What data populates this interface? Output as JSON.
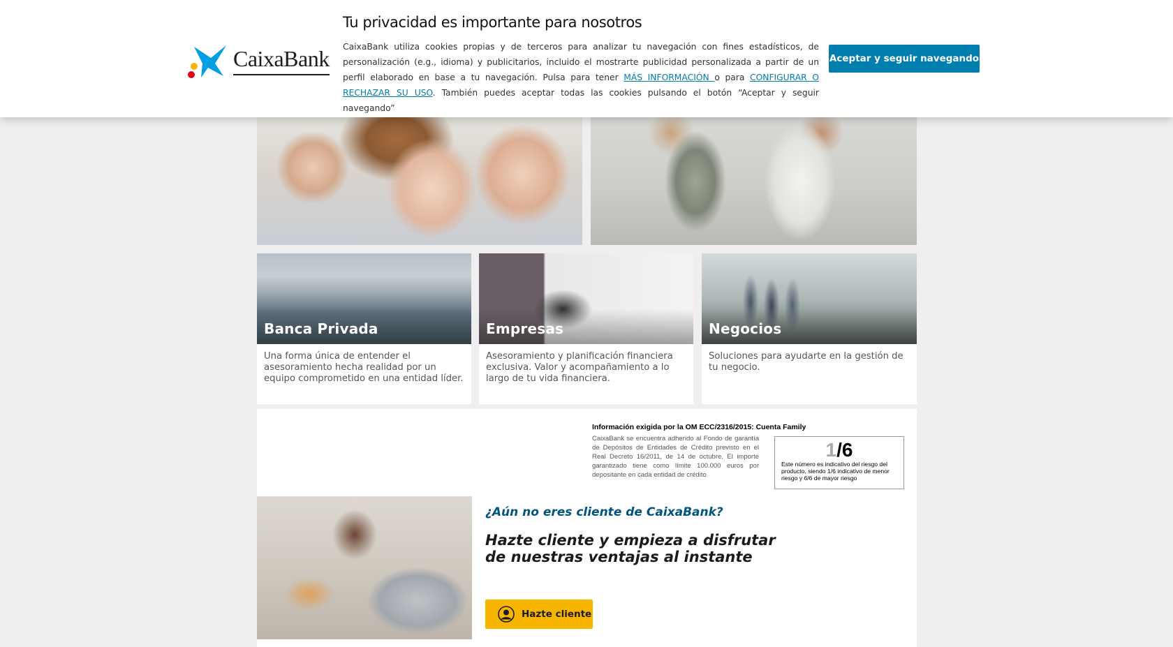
{
  "cookie_banner": {
    "logo_text": "CaixaBank",
    "title": "Tu privacidad es importante para nosotros",
    "text_part1": "CaixaBank utiliza cookies propias y de terceros para analizar tu navegación con fines estadísticos, de personalización (e.g., idioma) y publicitarios, incluido el mostrarte publicidad personalizada a partir de un perfil elaborado en base a tu navegación. Pulsa para tener ",
    "link_more": "MÁS INFORMACIÓN ",
    "text_part2": "o para ",
    "link_configure": "CONFIGURAR O RECHAZAR SU USO",
    "text_part3": ". También puedes aceptar todas las cookies pulsando el botón “Aceptar y seguir navegando”",
    "accept_button": "Aceptar y seguir navegando"
  },
  "cards": [
    {
      "title": "Banca Privada",
      "description": "Una forma única de entender el asesoramiento hecha realidad por un equipo comprometido en una entidad líder."
    },
    {
      "title": "Empresas",
      "description": "Asesoramiento y planificación financiera exclusiva. Valor y acompañamiento a lo largo de tu vida financiera."
    },
    {
      "title": "Negocios",
      "description": "Soluciones para ayudarte en la gestión de tu negocio."
    }
  ],
  "om_info": {
    "title": "Información exigida por la OM ECC/2316/2015: Cuenta Family",
    "text": "CaixaBank se encuentra adherido al Fondo de garantía de Depósitos de Entidades de Crédito previsto en el Real Decreto 16/2011, de 14 de octubre. El importe garantizado tiene como límite 100.000 euros por depositante en cada entidad de crédito",
    "risk_value": "1",
    "risk_total": "/6",
    "risk_text": "Este número es indicativo del riesgo del producto, siendo 1/6 indicativo de menor riesgo y 6/6 de mayor riesgo"
  },
  "promo": {
    "subtitle": "¿Aún no eres cliente de CaixaBank?",
    "title": "Hazte cliente y empieza a disfrutar de nuestras ventajas al instante",
    "button": "Hazte cliente",
    "button_icon": "user-icon"
  },
  "colors": {
    "accent_blue": "#007eae",
    "promo_blue": "#00547d",
    "button_yellow": "#f7b500",
    "logo_blue": "#009fe3"
  }
}
